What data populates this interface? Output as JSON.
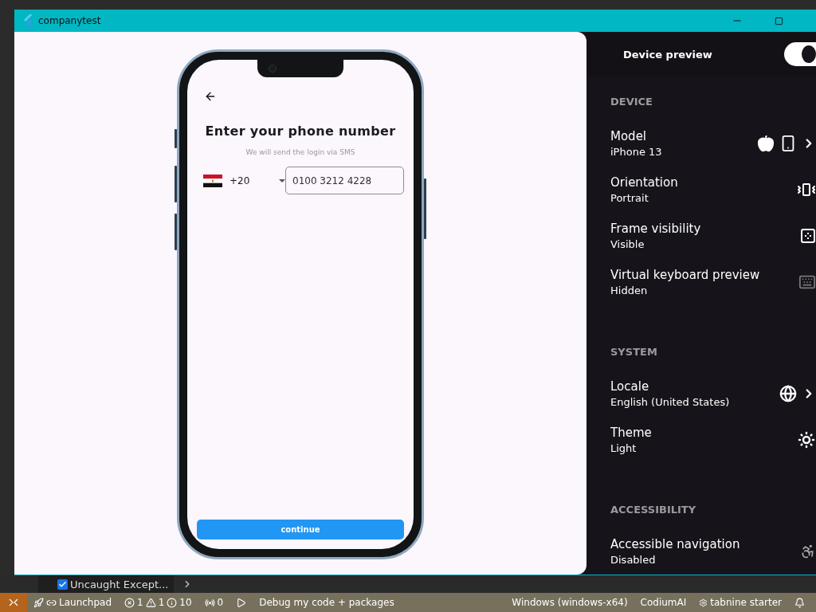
{
  "window": {
    "title": "companytest"
  },
  "phone_screen": {
    "title": "Enter your phone number",
    "subtitle": "We will send the login via SMS",
    "country_code": "+20",
    "phone_value": "0100 3212 4228",
    "button": "continue"
  },
  "device_preview": {
    "title": "Device preview",
    "enabled": true,
    "sections": [
      {
        "header": "DEVICE",
        "items": [
          {
            "kind": "model",
            "title": "Model",
            "value": "iPhone 13"
          },
          {
            "kind": "orientation",
            "title": "Orientation",
            "value": "Portrait"
          },
          {
            "kind": "frame",
            "title": "Frame visibility",
            "value": "Visible"
          },
          {
            "kind": "keyboard",
            "title": "Virtual keyboard preview",
            "value": "Hidden"
          }
        ]
      },
      {
        "header": "SYSTEM",
        "items": [
          {
            "kind": "locale",
            "title": "Locale",
            "value": "English (United States)"
          },
          {
            "kind": "theme",
            "title": "Theme",
            "value": "Light"
          }
        ]
      },
      {
        "header": "ACCESSIBILITY",
        "items": [
          {
            "kind": "accessibility",
            "title": "Accessible navigation",
            "value": "Disabled"
          }
        ]
      }
    ]
  },
  "panel": {
    "exception_filter": {
      "label": "Uncaught Except...",
      "checked": true
    }
  },
  "status_bar": {
    "left": [
      {
        "kind": "launchpad",
        "text": "Launchpad"
      },
      {
        "kind": "problems",
        "errors": "1",
        "warnings": "1",
        "infos": "10"
      },
      {
        "kind": "ports",
        "text": "0"
      },
      {
        "kind": "debug",
        "text": "Debug my code + packages"
      }
    ],
    "right": [
      {
        "kind": "plain",
        "text": "Windows (windows-x64)"
      },
      {
        "kind": "plain",
        "text": "CodiumAI"
      },
      {
        "kind": "tabnine",
        "text": "tabnine starter"
      },
      {
        "kind": "bell"
      }
    ]
  }
}
